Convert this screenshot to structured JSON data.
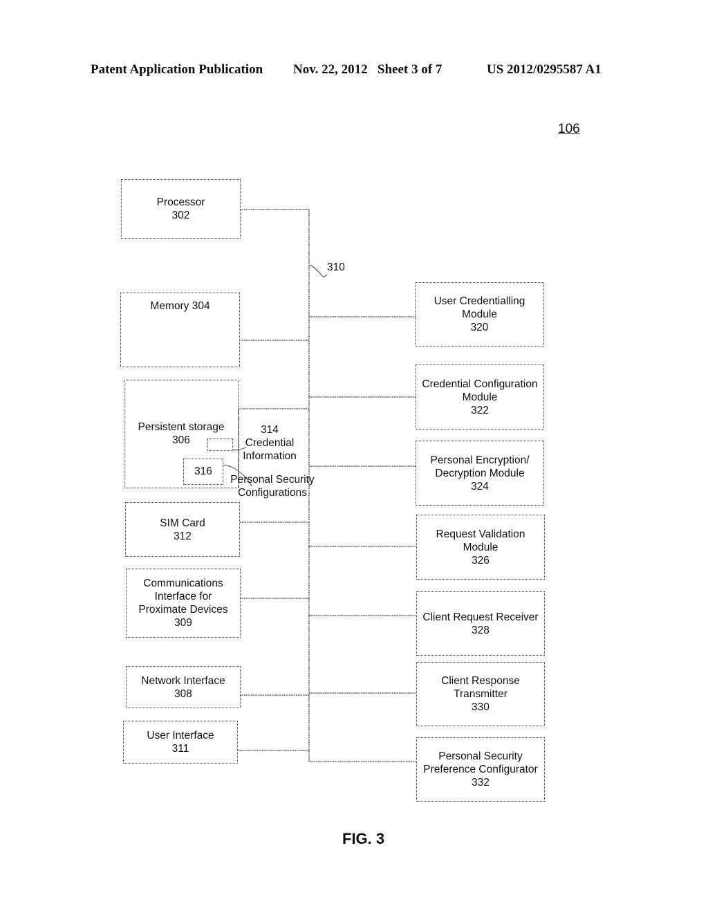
{
  "header": {
    "publication": "Patent Application Publication",
    "date_sheet": "Nov. 22, 2012   Sheet 3 of 7",
    "number": "US 2012/0295587 A1"
  },
  "ref_device": "106",
  "bus_label": "310",
  "left_boxes": [
    {
      "id": "processor",
      "label": "Processor\n302"
    },
    {
      "id": "memory",
      "label": "Memory 304"
    },
    {
      "id": "persistent-storage",
      "label": "Persistent storage\n306"
    },
    {
      "id": "sim-card",
      "label": "SIM Card\n312"
    },
    {
      "id": "comm-interface",
      "label": "Communications\nInterface for\nProximate Devices\n309"
    },
    {
      "id": "network-interface",
      "label": "Network Interface\n308"
    },
    {
      "id": "user-interface",
      "label": "User Interface\n311"
    }
  ],
  "storage_items": {
    "credential_box": "",
    "credential_label": "314\nCredential\nInformation",
    "security_box": "316",
    "security_label": "Personal Security\nConfigurations"
  },
  "right_boxes": [
    {
      "id": "user-credentialling-module",
      "label": "User Credentialling\nModule\n320"
    },
    {
      "id": "credential-configuration-module",
      "label": "Credential Configuration\nModule\n322"
    },
    {
      "id": "encryption-module",
      "label": "Personal Encryption/\nDecryption Module\n324"
    },
    {
      "id": "request-validation-module",
      "label": "Request Validation\nModule\n326"
    },
    {
      "id": "client-request-receiver",
      "label": "Client Request Receiver\n328"
    },
    {
      "id": "client-response-transmitter",
      "label": "Client Response\nTransmitter\n330"
    },
    {
      "id": "security-preference-configurator",
      "label": "Personal Security\nPreference Configurator\n332"
    }
  ],
  "figure_label": "FIG. 3"
}
